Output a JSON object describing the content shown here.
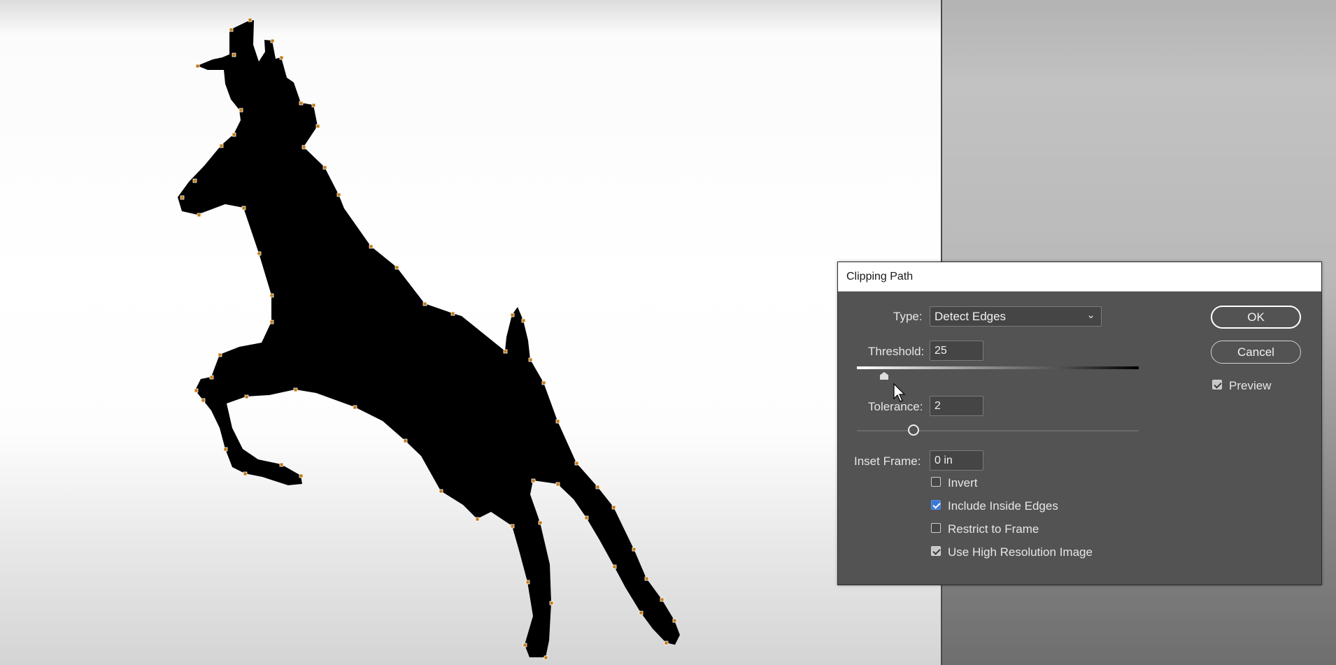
{
  "dialog": {
    "title": "Clipping Path",
    "type_label": "Type:",
    "type_value": "Detect Edges",
    "threshold_label": "Threshold:",
    "threshold_value": "25",
    "tolerance_label": "Tolerance:",
    "tolerance_value": "2",
    "inset_label": "Inset Frame:",
    "inset_value": "0 in",
    "ok_label": "OK",
    "cancel_label": "Cancel",
    "preview_label": "Preview",
    "preview_checked": true,
    "options": [
      {
        "label": "Invert",
        "checked": false
      },
      {
        "label": "Include Inside Edges",
        "checked": true
      },
      {
        "label": "Restrict to Frame",
        "checked": false
      },
      {
        "label": "Use High Resolution Image",
        "checked": true
      }
    ]
  },
  "colors": {
    "dialog_bg": "#535353",
    "path_anchor": "#c47a12",
    "checkbox_accent": "#3b78d8",
    "silhouette": "#000000"
  },
  "icons": {
    "dropdown": "chevron-down-icon",
    "cursor": "mouse-pointer-icon"
  }
}
